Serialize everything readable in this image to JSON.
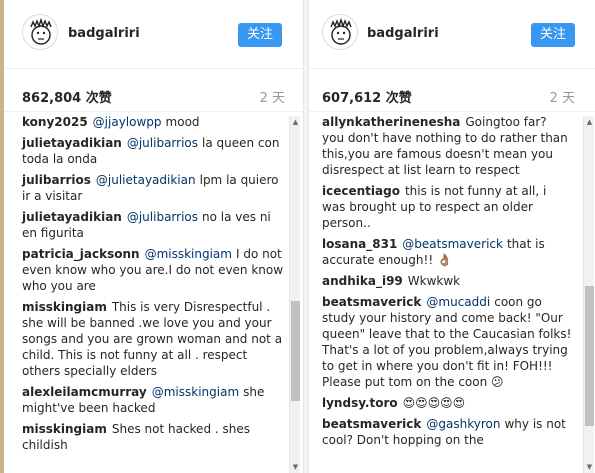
{
  "left_post": {
    "username": "badgalriri",
    "follow_label": "关注",
    "likes": "862,804 次赞",
    "time": "2 天",
    "comments": [
      {
        "user": "kony2025",
        "mention": "@jjaylowpp",
        "text": "mood"
      },
      {
        "user": "julietayadikian",
        "mention": "@julibarrios",
        "text": "la queen con toda la onda"
      },
      {
        "user": "julibarrios",
        "mention": "@julietayadikian",
        "text": "lpm la quiero ir a visitar"
      },
      {
        "user": "julietayadikian",
        "mention": "@julibarrios",
        "text": "no la ves ni en figurita"
      },
      {
        "user": "patricia_jacksonn",
        "mention": "@misskingiam",
        "text": "I do not even know who you are.I do not even know who you are"
      },
      {
        "user": "misskingiam",
        "mention": "",
        "text": "This is very Disrespectful . she will be banned .we love you and your songs and you are grown woman and not a child. This is not funny at all . respect others specially elders"
      },
      {
        "user": "alexleilamcmurray",
        "mention": "@misskingiam",
        "text": "she might've been hacked"
      },
      {
        "user": "misskingiam",
        "mention": "",
        "text": "Shes not hacked . shes childish"
      }
    ]
  },
  "right_post": {
    "username": "badgalriri",
    "follow_label": "关注",
    "likes": "607,612 次赞",
    "time": "2 天",
    "comments": [
      {
        "user": "allynkatherinenesha",
        "mention": "",
        "text": "Goingtoo far? you don't have nothing to do rather than this,you are famous doesn't mean you disrespect at list learn to respect"
      },
      {
        "user": "icecentiago",
        "mention": "",
        "text": "this is not funny at all, i was brought up to respect an older person.."
      },
      {
        "user": "losana_831",
        "mention": "@beatsmaverick",
        "text": "that is accurate enough!! 👌🏽"
      },
      {
        "user": "andhika_i99",
        "mention": "",
        "text": "Wkwkwk"
      },
      {
        "user": "beatsmaverick",
        "mention": "@mucaddi",
        "text": "coon go study your history and come back! \"Our queen\" leave that to the Caucasian folks! That's a lot of you problem,always trying to get in where you don't fit in! FOH!!! Please put tom on the coon 😕"
      },
      {
        "user": "lyndsy.toro",
        "mention": "",
        "text": "😍😍😍😍😍"
      },
      {
        "user": "beatsmaverick",
        "mention": "@gashkyron",
        "text": "why is not cool? Don't hopping on the"
      }
    ]
  }
}
